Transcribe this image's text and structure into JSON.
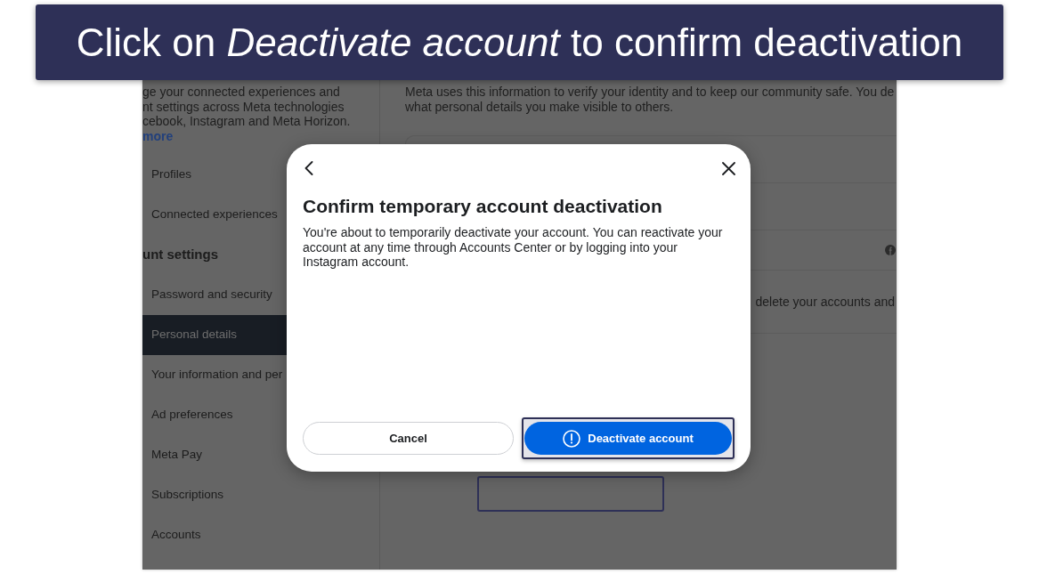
{
  "caption": "Click on *Deactivate account* to confirm deactivation",
  "sidebar": {
    "description": [
      "ge your connected experiences and",
      "nt settings across Meta technologies",
      "cebook, Instagram and Meta Horizon."
    ],
    "link": "more",
    "items": [
      {
        "kind": "item",
        "label": "Profiles",
        "selected": false
      },
      {
        "kind": "item",
        "label": "Connected experiences",
        "selected": false
      },
      {
        "kind": "heading",
        "label": "unt settings"
      },
      {
        "kind": "item",
        "label": "Password and security",
        "selected": false
      },
      {
        "kind": "item",
        "label": "Personal details",
        "selected": true
      },
      {
        "kind": "item",
        "label": "Your information and per",
        "selected": false
      },
      {
        "kind": "item",
        "label": "Ad preferences",
        "selected": false
      },
      {
        "kind": "item",
        "label": "Meta Pay",
        "selected": false
      },
      {
        "kind": "item",
        "label": "Subscriptions",
        "selected": false
      },
      {
        "kind": "item",
        "label": "Accounts",
        "selected": false
      }
    ]
  },
  "content": {
    "intro": [
      "Meta uses this information to verify your identity and to keep our community safe. You de",
      "what personal details you make visible to others."
    ],
    "card_text": "delete your accounts and"
  },
  "dialog": {
    "title": "Confirm temporary account deactivation",
    "body": "You're about to temporarily deactivate your account. You can reactivate your account at any time through Accounts Center or by logging into your Instagram account.",
    "buttons": [
      {
        "kind": "secondary",
        "label": "Cancel",
        "highlighted": false
      },
      {
        "kind": "primary",
        "label": "Deactivate account",
        "highlighted": true
      }
    ]
  }
}
